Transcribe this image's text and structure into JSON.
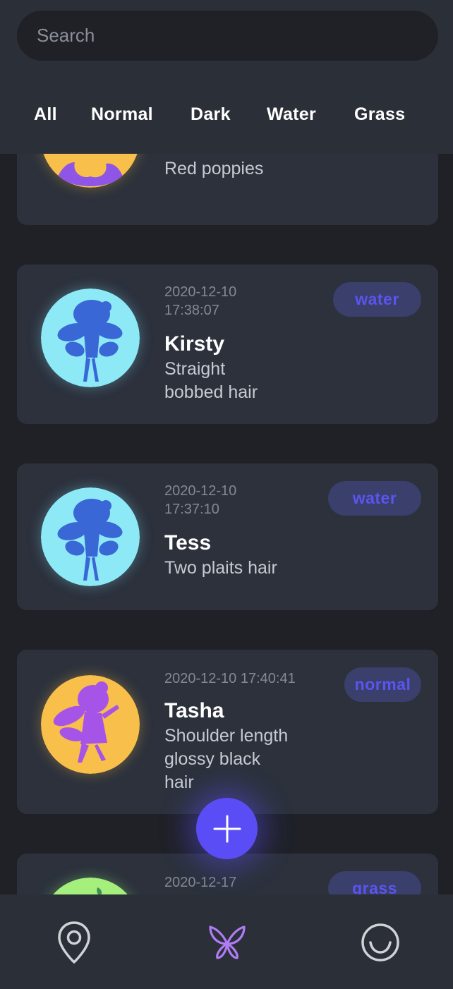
{
  "search": {
    "placeholder": "Search",
    "value": ""
  },
  "filters": [
    {
      "label": "All"
    },
    {
      "label": "Normal"
    },
    {
      "label": "Dark"
    },
    {
      "label": "Water"
    },
    {
      "label": "Grass"
    }
  ],
  "cards": [
    {
      "timestamp": "",
      "name": "",
      "description": "Red poppies",
      "tag": "",
      "avatar_color": "#f8bf4b",
      "silhouette_color": "#8f55e6"
    },
    {
      "timestamp": "2020-12-10\n17:38:07",
      "name": "Kirsty",
      "description": "Straight\nbobbed hair",
      "tag": "water",
      "avatar_color": "#8ee9f7",
      "silhouette_color": "#3a67d6"
    },
    {
      "timestamp": "2020-12-10\n17:37:10",
      "name": "Tess",
      "description": "Two plaits hair",
      "tag": "water",
      "avatar_color": "#8ee9f7",
      "silhouette_color": "#3a67d6"
    },
    {
      "timestamp": "2020-12-10 17:40:41",
      "name": "Tasha",
      "description": "Shoulder length\nglossy black\nhair",
      "tag": "normal",
      "avatar_color": "#f8bf4b",
      "silhouette_color": "#a654e8"
    },
    {
      "timestamp": "2020-12-17",
      "name": "",
      "description": "",
      "tag": "grass",
      "avatar_color": "#a5f07d",
      "silhouette_color": "#3f8f55"
    }
  ],
  "fab": {
    "icon": "plus-icon"
  },
  "nav": [
    {
      "icon": "location-pin-icon",
      "active": false
    },
    {
      "icon": "butterfly-icon",
      "active": true
    },
    {
      "icon": "smile-icon",
      "active": false
    }
  ],
  "colors": {
    "background": "#1f2127",
    "surface": "#2c313c",
    "header": "#2b2f38",
    "accent": "#5b4df5",
    "tag_text": "#5a55ee",
    "tag_bg": "#3a3f6b",
    "nav_active": "#b07cf5",
    "nav_inactive": "#d0d2d6"
  }
}
